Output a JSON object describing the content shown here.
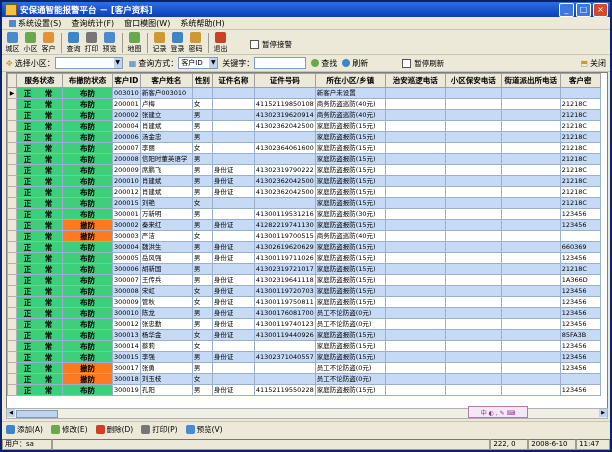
{
  "window": {
    "title": "安保通智能报警平台 － [客户资料]",
    "min": "_",
    "max": "□",
    "close": "×"
  },
  "menu": [
    {
      "label": "系统设置(S)"
    },
    {
      "label": "查询统计(F)"
    },
    {
      "label": "窗口模图(W)"
    },
    {
      "label": "系统帮助(H)"
    }
  ],
  "toolbar": {
    "items": [
      {
        "label": "城区",
        "color": "#4a8bd0"
      },
      {
        "label": "小区",
        "color": "#6aa84f"
      },
      {
        "label": "客户",
        "color": "#e69138"
      },
      {
        "label": "查询",
        "color": "#3d85c6"
      },
      {
        "label": "打印",
        "color": "#777777"
      },
      {
        "label": "预览",
        "color": "#4a8bd0"
      },
      {
        "label": "地图",
        "color": "#6aa84f"
      },
      {
        "label": "记录",
        "color": "#cc9933"
      },
      {
        "label": "登录",
        "color": "#3d85c6"
      },
      {
        "label": "密码",
        "color": "#cc9933"
      },
      {
        "label": "退出",
        "color": "#cc4125"
      }
    ],
    "pause_label": "暂停接警"
  },
  "filter": {
    "select_label": "选择小区：",
    "select_value": "",
    "query_mode_label": "查询方式：",
    "query_mode_value": "客户ID",
    "keyword_label": "关键字：",
    "keyword_value": "",
    "search_label": "查找",
    "refresh_label": "刷新",
    "pause_refresh_label": "暂停刷新",
    "close_label": "关闭"
  },
  "columns": [
    "服务状态",
    "布撤防状态",
    "客户ID",
    "客户姓名",
    "性别",
    "证件名称",
    "证件号码",
    "所在小区/乡镇",
    "治安巡逻电话",
    "小区保安电话",
    "街道派出所电话",
    "客户密"
  ],
  "rows": [
    {
      "s": "正　常",
      "d": "布防",
      "id": "003010",
      "name": "新客户003010",
      "sex": "",
      "cert": "",
      "num": "",
      "area": "新客户未设置",
      "x": ""
    },
    {
      "s": "正　常",
      "d": "布防",
      "id": "200001",
      "name": "卢梅",
      "sex": "女",
      "cert": "",
      "num": "41152119850108",
      "area": "商务防盗巡防(40元)",
      "x": "21218C"
    },
    {
      "s": "正　常",
      "d": "布防",
      "id": "200002",
      "name": "张建立",
      "sex": "男",
      "cert": "",
      "num": "41302319620914",
      "area": "商务防盗巡防(40元)",
      "x": "21218C"
    },
    {
      "s": "正　常",
      "d": "布防",
      "id": "200004",
      "name": "肖建斌",
      "sex": "男",
      "cert": "",
      "num": "41302362042500",
      "area": "家庭防盗报防(15元)",
      "x": "21218C"
    },
    {
      "s": "正　常",
      "d": "布防",
      "id": "200006",
      "name": "汤金忠",
      "sex": "男",
      "cert": "",
      "num": "",
      "area": "家庭防盗报防(15元)",
      "x": "21218C"
    },
    {
      "s": "正　常",
      "d": "布防",
      "id": "200007",
      "name": "李丽",
      "sex": "女",
      "cert": "",
      "num": "41302364061600",
      "area": "家庭防盗报防(15元)",
      "x": "21218C"
    },
    {
      "s": "正　常",
      "d": "布防",
      "id": "200008",
      "name": "信阳时董英语学",
      "sex": "男",
      "cert": "",
      "num": "",
      "area": "家庭防盗报防(15元)",
      "x": "21218C"
    },
    {
      "s": "正　常",
      "d": "布防",
      "id": "200009",
      "name": "席鹏飞",
      "sex": "男",
      "cert": "身份证",
      "num": "41302319790222",
      "area": "家庭防盗报防(15元)",
      "x": "21218C"
    },
    {
      "s": "正　常",
      "d": "布防",
      "id": "200010",
      "name": "肖建斌",
      "sex": "男",
      "cert": "身份证",
      "num": "41302362042500",
      "area": "家庭防盗报防(15元)",
      "x": "21218C"
    },
    {
      "s": "正　常",
      "d": "布防",
      "id": "200012",
      "name": "肖建斌",
      "sex": "男",
      "cert": "身份证",
      "num": "41302362042500",
      "area": "家庭防盗报防(15元)",
      "x": "21218C"
    },
    {
      "s": "正　常",
      "d": "布防",
      "id": "200015",
      "name": "刘艳",
      "sex": "女",
      "cert": "",
      "num": "",
      "area": "家庭防盗报防(15元)",
      "x": "21218C"
    },
    {
      "s": "正　常",
      "d": "布防",
      "id": "300001",
      "name": "万新明",
      "sex": "男",
      "cert": "",
      "num": "41300119531216",
      "area": "家庭防盗报防(30元)",
      "x": "123456"
    },
    {
      "s": "正　常",
      "d": "撤防",
      "id": "300002",
      "name": "秦来红",
      "sex": "男",
      "cert": "身份证",
      "num": "41282219741130",
      "area": "家庭防盗报防(15元)",
      "x": "123456"
    },
    {
      "s": "正　常",
      "d": "撤防",
      "id": "300003",
      "name": "严洁",
      "sex": "女",
      "cert": "",
      "num": "41300119700515",
      "area": "商务防盗巡防(40元)",
      "x": ""
    },
    {
      "s": "正　常",
      "d": "布防",
      "id": "300004",
      "name": "魏洪生",
      "sex": "男",
      "cert": "身份证",
      "num": "41302619620629",
      "area": "家庭防盗报防(15元)",
      "x": "660369"
    },
    {
      "s": "正　常",
      "d": "布防",
      "id": "300005",
      "name": "岳风强",
      "sex": "男",
      "cert": "身份证",
      "num": "41300119711026",
      "area": "家庭防盗报防(15元)",
      "x": "123456"
    },
    {
      "s": "正　常",
      "d": "布防",
      "id": "300006",
      "name": "胡新国",
      "sex": "男",
      "cert": "",
      "num": "41302319721017",
      "area": "家庭防盗报防(15元)",
      "x": "21218C"
    },
    {
      "s": "正　常",
      "d": "布防",
      "id": "300007",
      "name": "王传兵",
      "sex": "男",
      "cert": "身份证",
      "num": "41302319641118",
      "area": "家庭防盗报防(15元)",
      "x": "1A366D"
    },
    {
      "s": "正　常",
      "d": "布防",
      "id": "300008",
      "name": "宋虹",
      "sex": "女",
      "cert": "身份证",
      "num": "41300119720703",
      "area": "家庭防盗报防(15元)",
      "x": "123456"
    },
    {
      "s": "正　常",
      "d": "布防",
      "id": "300009",
      "name": "管秋",
      "sex": "女",
      "cert": "身份证",
      "num": "41300119750811",
      "area": "家庭防盗报防(15元)",
      "x": "123456"
    },
    {
      "s": "正　常",
      "d": "布防",
      "id": "300010",
      "name": "陈龙",
      "sex": "男",
      "cert": "身份证",
      "num": "41300176081700",
      "area": "员工不论防盗(0元)",
      "x": "123456"
    },
    {
      "s": "正　常",
      "d": "布防",
      "id": "300012",
      "name": "张忠勤",
      "sex": "男",
      "cert": "身份证",
      "num": "41300119740123",
      "area": "员工不论防盗(0元)",
      "x": "123456"
    },
    {
      "s": "正　常",
      "d": "布防",
      "id": "300013",
      "name": "杨华金",
      "sex": "女",
      "cert": "身份证",
      "num": "41300119440926",
      "area": "家庭防盗报防(15元)",
      "x": "85FA3B"
    },
    {
      "s": "正　常",
      "d": "布防",
      "id": "300014",
      "name": "蔡莉",
      "sex": "女",
      "cert": "",
      "num": "",
      "area": "家庭防盗报防(15元)",
      "x": "123456"
    },
    {
      "s": "正　常",
      "d": "布防",
      "id": "300015",
      "name": "李强",
      "sex": "男",
      "cert": "身份证",
      "num": "41302371040557",
      "area": "家庭防盗报防(15元)",
      "x": "123456"
    },
    {
      "s": "正　常",
      "d": "撤防",
      "id": "300017",
      "name": "张勇",
      "sex": "男",
      "cert": "",
      "num": "",
      "area": "员工不论防盗(0元)",
      "x": "123456"
    },
    {
      "s": "正　常",
      "d": "撤防",
      "id": "300018",
      "name": "刘玉枝",
      "sex": "女",
      "cert": "",
      "num": "",
      "area": "员工不论防盗(0元)",
      "x": ""
    },
    {
      "s": "正　常",
      "d": "布防",
      "id": "300019",
      "name": "孔阳",
      "sex": "男",
      "cert": "身份证",
      "num": "41152119550228",
      "area": "家庭防盗报防(15元)",
      "x": "123456"
    }
  ],
  "ime": "中 ◐ , ✎ ⌨",
  "bottom": [
    {
      "label": "添加(A)",
      "color": "#3d85c6"
    },
    {
      "label": "修改(E)",
      "color": "#6aa84f"
    },
    {
      "label": "删除(D)",
      "color": "#cc4125"
    },
    {
      "label": "打印(P)",
      "color": "#777777"
    },
    {
      "label": "预览(V)",
      "color": "#4a8bd0"
    }
  ],
  "status": {
    "user": "用户：sa",
    "coord": "222, 0",
    "date": "2008-6-10",
    "time": "11:47"
  }
}
